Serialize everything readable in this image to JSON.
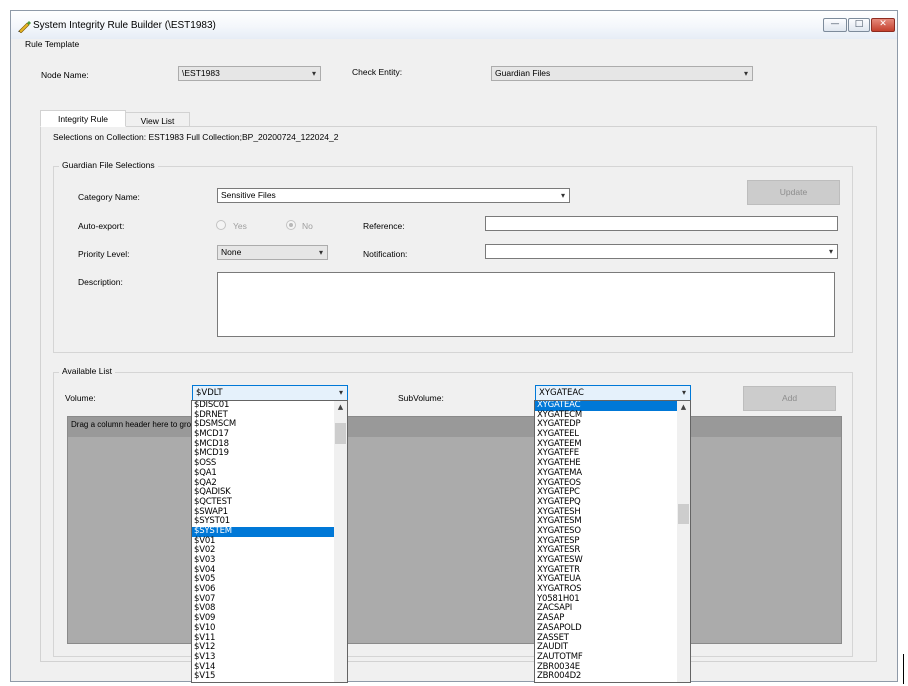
{
  "window": {
    "title": "System Integrity Rule Builder (\\EST1983)",
    "controls": {
      "minimize": "—",
      "maximize": "□",
      "close": "✕"
    }
  },
  "menu": {
    "rule_template": "Rule Template"
  },
  "header": {
    "node_label": "Node Name:",
    "node_value": "\\EST1983",
    "entity_label": "Check Entity:",
    "entity_value": "Guardian Files"
  },
  "tabs": [
    {
      "label": "Integrity Rule",
      "active": true
    },
    {
      "label": "View List",
      "active": false
    }
  ],
  "selections_text": "Selections on Collection: EST1983 Full Collection;BP_20200724_122024_2",
  "guardian_group": {
    "title": "Guardian File Selections",
    "category_label": "Category Name:",
    "category_value": "Sensitive Files",
    "update_label": "Update",
    "autoexport_label": "Auto-export:",
    "yes_label": "Yes",
    "no_label": "No",
    "reference_label": "Reference:",
    "reference_value": "",
    "priority_label": "Priority Level:",
    "priority_value": "None",
    "notification_label": "Notification:",
    "notification_value": "",
    "description_label": "Description:",
    "description_value": ""
  },
  "available_group": {
    "title": "Available List",
    "volume_label": "Volume:",
    "volume_value": "$VDLT",
    "subvolume_label": "SubVolume:",
    "subvolume_value": "XYGATEAC",
    "add_label": "Add",
    "grid_hint": "Drag a column header here to grou"
  },
  "volume_options": [
    "$DISC01",
    "$DRNET",
    "$DSMSCM",
    "$MCD17",
    "$MCD18",
    "$MCD19",
    "$OSS",
    "$QA1",
    "$QA2",
    "$QADISK",
    "$QCTEST",
    "$SWAP1",
    "$SYST01",
    "$SYSTEM",
    "$V01",
    "$V02",
    "$V03",
    "$V04",
    "$V05",
    "$V06",
    "$V07",
    "$V08",
    "$V09",
    "$V10",
    "$V11",
    "$V12",
    "$V13",
    "$V14",
    "$V15"
  ],
  "volume_selected": "$SYSTEM",
  "subvolume_options": [
    "XYGATEAC",
    "XYGATECM",
    "XYGATEDP",
    "XYGATEEL",
    "XYGATEEM",
    "XYGATEFE",
    "XYGATEHE",
    "XYGATEMA",
    "XYGATEOS",
    "XYGATEPC",
    "XYGATEPQ",
    "XYGATESH",
    "XYGATESM",
    "XYGATESO",
    "XYGATESP",
    "XYGATESR",
    "XYGATESW",
    "XYGATETR",
    "XYGATEUA",
    "XYGATROS",
    "Y0581H01",
    "ZACSAPI",
    "ZASAP",
    "ZASAPOLD",
    "ZASSET",
    "ZAUDIT",
    "ZAUTOTMF",
    "ZBR0034E",
    "ZBR004D2"
  ],
  "subvolume_selected": "XYGATEAC",
  "icons": {
    "dropdown": "▾",
    "scroll_up": "▲",
    "app": "pen-icon"
  }
}
